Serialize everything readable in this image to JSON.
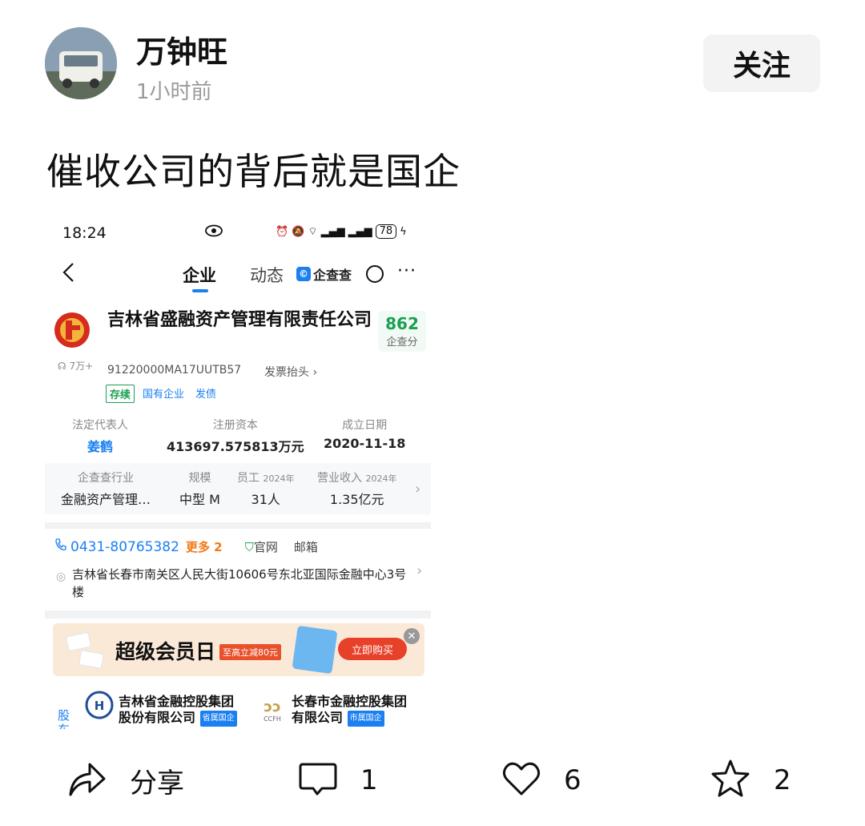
{
  "post": {
    "author": "万钟旺",
    "time": "1小时前",
    "follow_label": "关注",
    "text": "催收公司的背后就是国企"
  },
  "screenshot": {
    "status_bar": {
      "time": "18:24",
      "battery": "78"
    },
    "nav": {
      "tab_active": "企业",
      "tab_other": "动态",
      "brand": "企查查",
      "more": "···"
    },
    "company": {
      "name": "吉林省盛融资产管理有限责任公司",
      "followers": "7万+",
      "score": "862",
      "score_label": "企查分",
      "credit_code": "91220000MA17UUTB57",
      "invoice_label": "发票抬头",
      "tags": [
        "存续",
        "国有企业",
        "发债"
      ]
    },
    "info": [
      {
        "label": "法定代表人",
        "value": "姜鹤"
      },
      {
        "label": "注册资本",
        "value": "413697.575813万元"
      },
      {
        "label": "成立日期",
        "value": "2020-11-18"
      }
    ],
    "stats": [
      {
        "label": "企查查行业",
        "sub": "",
        "value": "金融资产管理…"
      },
      {
        "label": "规模",
        "sub": "",
        "value": "中型 M"
      },
      {
        "label": "员工",
        "sub": "2024年",
        "value": "31人"
      },
      {
        "label": "营业收入",
        "sub": "2024年",
        "value": "1.35亿元"
      }
    ],
    "contact": {
      "phone": "0431-80765382",
      "more": "更多 2",
      "website": "官网",
      "email": "邮箱",
      "address": "吉林省长春市南关区人民大街10606号东北亚国际金融中心3号楼"
    },
    "banner": {
      "title": "超级会员日",
      "discount": "至高立减80元",
      "buy": "立即购买"
    },
    "shareholders": {
      "section_label": "股东",
      "items": [
        {
          "name_line1": "吉林省金融控股集团",
          "name_line2": "股份有限公司",
          "tag": "省属国企"
        },
        {
          "name_line1": "长春市金融控股集团",
          "name_line2": "有限公司",
          "tag": "市属国企",
          "logo_text": "CCFH"
        }
      ]
    }
  },
  "actions": {
    "share": "分享",
    "comments": "1",
    "likes": "6",
    "favorites": "2"
  },
  "colors": {
    "accent_blue": "#1a7ff0",
    "score_green": "#1aa050",
    "orange": "#f07a1a",
    "banner_bg": "#fbe9d8"
  }
}
